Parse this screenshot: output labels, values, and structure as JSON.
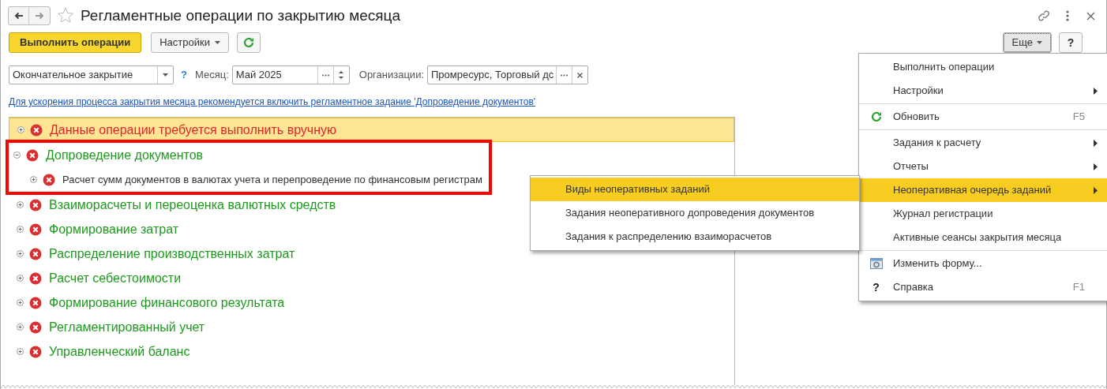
{
  "window": {
    "title": "Регламентные операции по закрытию месяца"
  },
  "toolbar": {
    "primary_button": "Выполнить операции",
    "settings_button": "Настройки",
    "more_button": "Еще",
    "help_button": "?"
  },
  "filters": {
    "mode": {
      "value": "Окончательное закрытие"
    },
    "help": "?",
    "month_label": "Месяц:",
    "month": {
      "value": "Май 2025"
    },
    "org_label": "Организации:",
    "org": {
      "value": "Промресурс, Торговый дс"
    }
  },
  "notice_link": "Для ускорения процесса закрытия месяца рекомендуется включить регламентное задание 'Допроведение документов'",
  "tree": [
    {
      "label": "Данные операции требуется выполнить вручную",
      "kind": "manual",
      "selected": true,
      "expanded": false,
      "highlighted": false
    },
    {
      "label": "Допроведение документов",
      "kind": "group",
      "selected": false,
      "expanded": true,
      "highlighted": true,
      "children": [
        {
          "label": "Расчет сумм документов в валютах учета и перепроведение по финансовым регистрам",
          "kind": "operation",
          "selected": false,
          "expanded": false
        }
      ]
    },
    {
      "label": "Взаиморасчеты и переоценка валютных средств",
      "kind": "group",
      "selected": false,
      "expanded": false,
      "highlighted": false
    },
    {
      "label": "Формирование затрат",
      "kind": "group",
      "selected": false,
      "expanded": false,
      "highlighted": false
    },
    {
      "label": "Распределение производственных затрат",
      "kind": "group",
      "selected": false,
      "expanded": false,
      "highlighted": false
    },
    {
      "label": "Расчет себестоимости",
      "kind": "group",
      "selected": false,
      "expanded": false,
      "highlighted": false
    },
    {
      "label": "Формирование финансового результата",
      "kind": "group",
      "selected": false,
      "expanded": false,
      "highlighted": false
    },
    {
      "label": "Регламентированный учет",
      "kind": "group",
      "selected": false,
      "expanded": false,
      "highlighted": false
    },
    {
      "label": "Управленческий баланс",
      "kind": "group",
      "selected": false,
      "expanded": false,
      "highlighted": false
    }
  ],
  "more_menu": [
    {
      "label": "Выполнить операции",
      "kind": "item",
      "selected": false,
      "separator_before": false
    },
    {
      "label": "Настройки",
      "kind": "submenu",
      "selected": false,
      "separator_before": false
    },
    {
      "label": "Обновить",
      "kind": "refresh",
      "shortcut": "F5",
      "selected": false,
      "separator_before": true
    },
    {
      "label": "Задания к расчету",
      "kind": "submenu",
      "selected": false,
      "separator_before": true
    },
    {
      "label": "Отчеты",
      "kind": "submenu",
      "selected": false,
      "separator_before": false
    },
    {
      "label": "Неоперативная очередь заданий",
      "kind": "submenu",
      "selected": true,
      "separator_before": false
    },
    {
      "label": "Журнал регистрации",
      "kind": "item",
      "selected": false,
      "separator_before": false
    },
    {
      "label": "Активные сеансы закрытия месяца",
      "kind": "item",
      "selected": false,
      "separator_before": false
    },
    {
      "label": "Изменить форму...",
      "kind": "form",
      "selected": false,
      "separator_before": true
    },
    {
      "label": "Справка",
      "kind": "help",
      "icon_text": "?",
      "shortcut": "F1",
      "selected": false,
      "separator_before": false
    }
  ],
  "submenu": [
    {
      "label": "Виды неоперативных заданий",
      "selected": true
    },
    {
      "label": "Задания неоперативного допроведения документов",
      "selected": false
    },
    {
      "label": "Задания к распределению взаиморасчетов",
      "selected": false
    }
  ]
}
